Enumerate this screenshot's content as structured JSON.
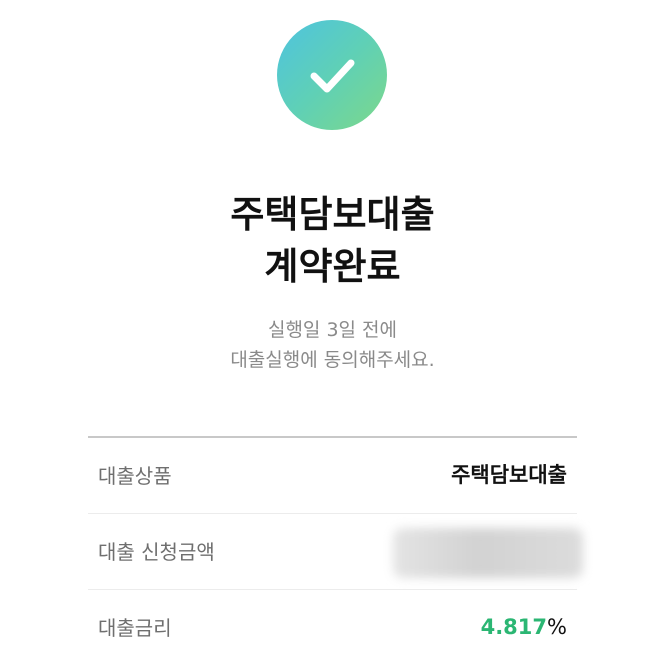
{
  "status": {
    "icon": "check-icon",
    "title_line1": "주택담보대출",
    "title_line2": "계약완료",
    "description_line1": "실행일 3일 전에",
    "description_line2": "대출실행에 동의해주세요."
  },
  "details": [
    {
      "label": "대출상품",
      "value": "주택담보대출"
    },
    {
      "label": "대출 신청금액",
      "value": ""
    },
    {
      "label": "대출금리",
      "value": "4.817",
      "unit": "%"
    }
  ],
  "colors": {
    "accent_green": "#2bb673",
    "gradient_start": "#4ec3e0",
    "gradient_end": "#7dd88a"
  }
}
